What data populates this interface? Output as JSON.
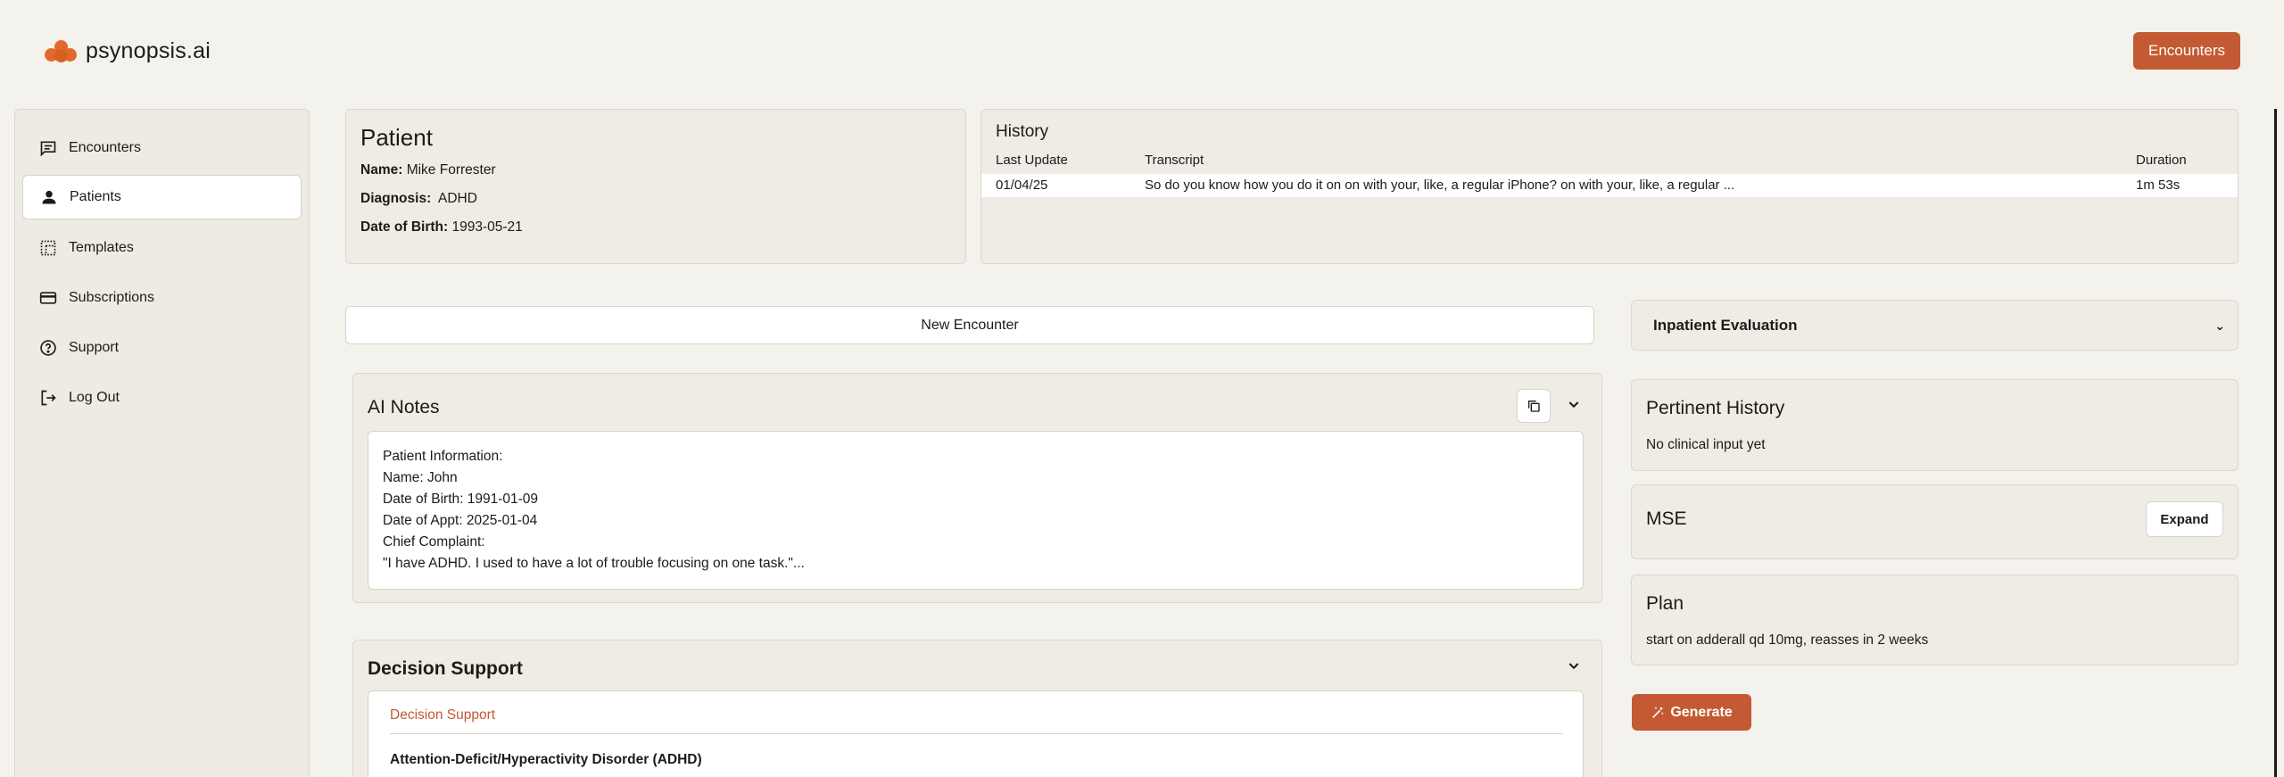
{
  "app": {
    "brand": "psynopsis.ai"
  },
  "header": {
    "encounters_button": "Encounters"
  },
  "sidebar": {
    "items": [
      {
        "label": "Encounters",
        "icon": "chat-list-icon"
      },
      {
        "label": "Patients",
        "icon": "person-icon",
        "active": true
      },
      {
        "label": "Templates",
        "icon": "template-icon"
      },
      {
        "label": "Subscriptions",
        "icon": "credit-card-icon"
      },
      {
        "label": "Support",
        "icon": "help-circle-icon"
      },
      {
        "label": "Log Out",
        "icon": "logout-icon"
      }
    ]
  },
  "patient": {
    "title": "Patient",
    "name_label": "Name:",
    "name": "Mike Forrester",
    "diagnosis_label": "Diagnosis:",
    "diagnosis": "ADHD",
    "dob_label": "Date of Birth:",
    "dob": "1993-05-21"
  },
  "history": {
    "title": "History",
    "columns": [
      "Last Update",
      "Transcript",
      "Duration"
    ],
    "rows": [
      {
        "last_update": "01/04/25",
        "transcript": "So do you know how you do it on on with your, like, a regular iPhone? on with your, like, a regular ...",
        "duration": "1m 53s"
      }
    ]
  },
  "new_encounter_button": "New Encounter",
  "template_select": {
    "value": "Inpatient Evaluation"
  },
  "ai_notes": {
    "title": "AI Notes",
    "lines": [
      "Patient Information:",
      "Name: John",
      "Date of Birth: 1991-01-09",
      "Date of Appt: 2025-01-04",
      "Chief Complaint:",
      "\"I have ADHD. I used to have a lot of trouble focusing on one task.\"..."
    ]
  },
  "decision_support": {
    "title": "Decision Support",
    "subtitle": "Decision Support",
    "item": "Attention-Deficit/Hyperactivity Disorder (ADHD)"
  },
  "pertinent_history": {
    "title": "Pertinent History",
    "text": "No clinical input yet"
  },
  "mse": {
    "title": "MSE",
    "expand_label": "Expand"
  },
  "plan": {
    "title": "Plan",
    "text": "start on adderall qd 10mg, reasses in 2 weeks"
  },
  "generate_button": "Generate",
  "colors": {
    "accent": "#c45a33",
    "background": "#f4f2ed",
    "panel": "#efece5"
  }
}
